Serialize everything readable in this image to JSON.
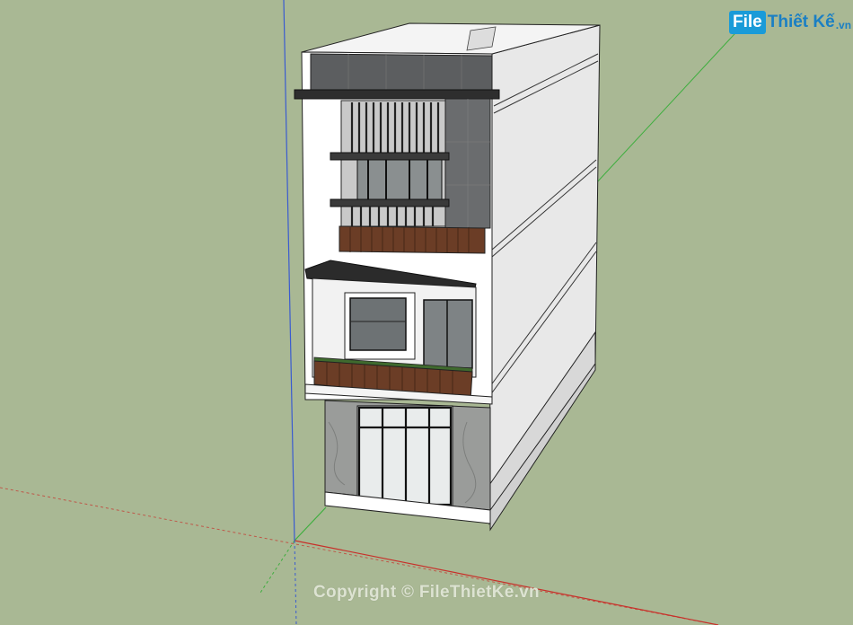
{
  "logo": {
    "box_text": "File",
    "main_text": "Thiết Kế",
    "suffix_text": ".vn",
    "color": "#1a9bd8"
  },
  "watermark": {
    "text": "Copyright © FileThietKe.vn"
  },
  "colors": {
    "ground": "#a9b894",
    "axis_red": "#c8302a",
    "axis_green": "#3fae3f",
    "axis_blue": "#3a5bd0",
    "wall_white": "#ffffff",
    "wall_side": "#e6e6e6",
    "tile_dark": "#5e6062",
    "wood": "#6b3d26",
    "marble": "#9a9c9a"
  }
}
